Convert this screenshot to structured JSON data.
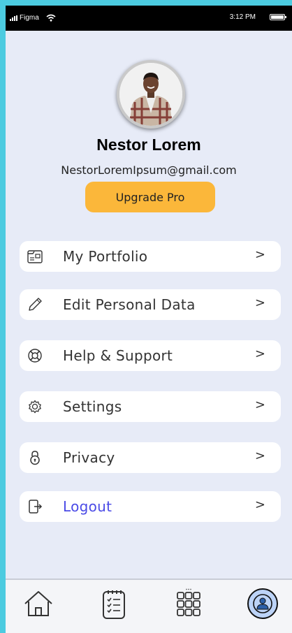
{
  "status_bar": {
    "carrier": "Figma",
    "time": "3:12 PM"
  },
  "profile": {
    "name": "Nestor Lorem",
    "email": "NestorLoremIpsum@gmail.com",
    "upgrade_label": "Upgrade Pro"
  },
  "menu": {
    "items": [
      {
        "label": "My Portfolio",
        "icon": "portfolio-icon",
        "chevron": ">"
      },
      {
        "label": "Edit Personal Data",
        "icon": "pencil-icon",
        "chevron": ">"
      },
      {
        "label": "Help & Support",
        "icon": "lifebuoy-icon",
        "chevron": ">"
      },
      {
        "label": "Settings",
        "icon": "gear-icon",
        "chevron": ">"
      },
      {
        "label": "Privacy",
        "icon": "lock-icon",
        "chevron": ">"
      },
      {
        "label": "Logout",
        "icon": "logout-icon",
        "chevron": ">"
      }
    ]
  },
  "bottom_nav": {
    "items": [
      {
        "icon": "home-icon"
      },
      {
        "icon": "clipboard-icon"
      },
      {
        "icon": "grid-icon"
      },
      {
        "icon": "profile-icon",
        "active": true
      }
    ]
  },
  "colors": {
    "frame": "#4ccbe0",
    "background": "#e7ebf7",
    "accent": "#fbb73a",
    "logout": "#4a4ae6",
    "active_nav": "#bcd3f7"
  }
}
